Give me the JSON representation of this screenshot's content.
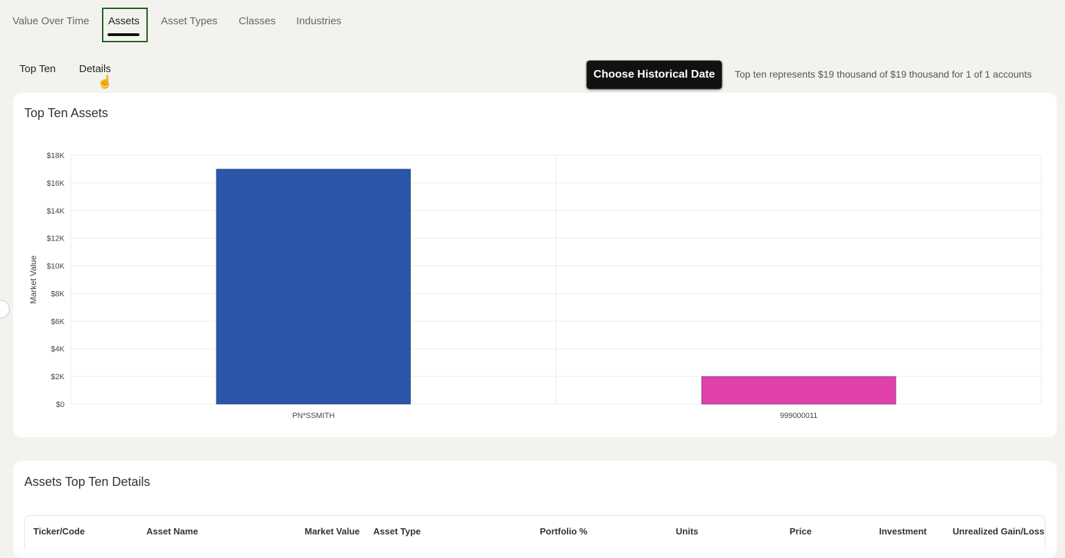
{
  "tabs": [
    {
      "label": "Value Over Time"
    },
    {
      "label": "Assets"
    },
    {
      "label": "Asset Types"
    },
    {
      "label": "Classes"
    },
    {
      "label": "Industries"
    }
  ],
  "subtabs": [
    {
      "label": "Top Ten"
    },
    {
      "label": "Details"
    }
  ],
  "historical_button": "Choose Historical Date",
  "summary_text": "Top ten represents $19 thousand of $19 thousand for 1 of 1 accounts",
  "chart_card": {
    "title": "Top Ten Assets"
  },
  "chart_data": {
    "type": "bar",
    "categories": [
      "PN*SSMITH",
      "999000011"
    ],
    "values": [
      17000,
      2000
    ],
    "colors": [
      "#2b55a8",
      "#e040a8"
    ],
    "ylabel": "Market Value",
    "ylim": [
      0,
      18000
    ],
    "yticks": [
      "$0",
      "$2K",
      "$4K",
      "$6K",
      "$8K",
      "$10K",
      "$12K",
      "$14K",
      "$16K",
      "$18K"
    ],
    "grid": true
  },
  "details_card": {
    "title": "Assets Top Ten Details",
    "columns": [
      "Ticker/Code",
      "Asset Name",
      "Market Value",
      "Asset Type",
      "Portfolio %",
      "Units",
      "Price",
      "Investment",
      "Unrealized Gain/Loss"
    ]
  }
}
